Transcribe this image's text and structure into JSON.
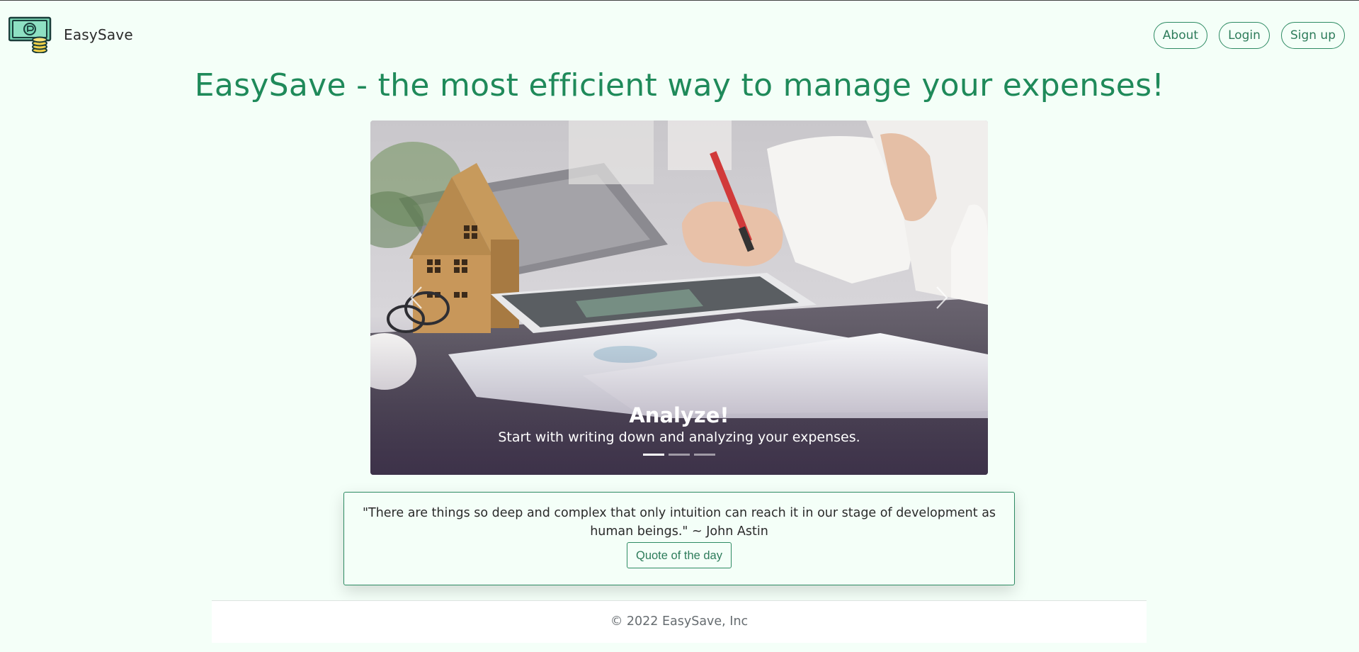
{
  "brand": {
    "name": "EasySave",
    "logo_icon": "money-bill-coins-icon"
  },
  "nav": {
    "items": [
      {
        "label": "About"
      },
      {
        "label": "Login"
      },
      {
        "label": "Sign up"
      }
    ]
  },
  "main": {
    "title": "EasySave - the most efficient way to manage your expenses!"
  },
  "carousel": {
    "prev_icon": "chevron-left-icon",
    "next_icon": "chevron-right-icon",
    "active_slide": {
      "title": "Analyze!",
      "text": "Start with writing down and analyzing your expenses."
    },
    "slide_count": 3,
    "active_index": 0
  },
  "quote": {
    "text": "\"There are things so deep and complex that only intuition can reach it in our stage of development as human beings.\" ~ John Astin",
    "button_label": "Quote of the day"
  },
  "footer": {
    "text": "© 2022 EasySave, Inc"
  },
  "colors": {
    "background": "#f4fff8",
    "accent": "#1f8a5a",
    "border": "#2e8b63"
  }
}
